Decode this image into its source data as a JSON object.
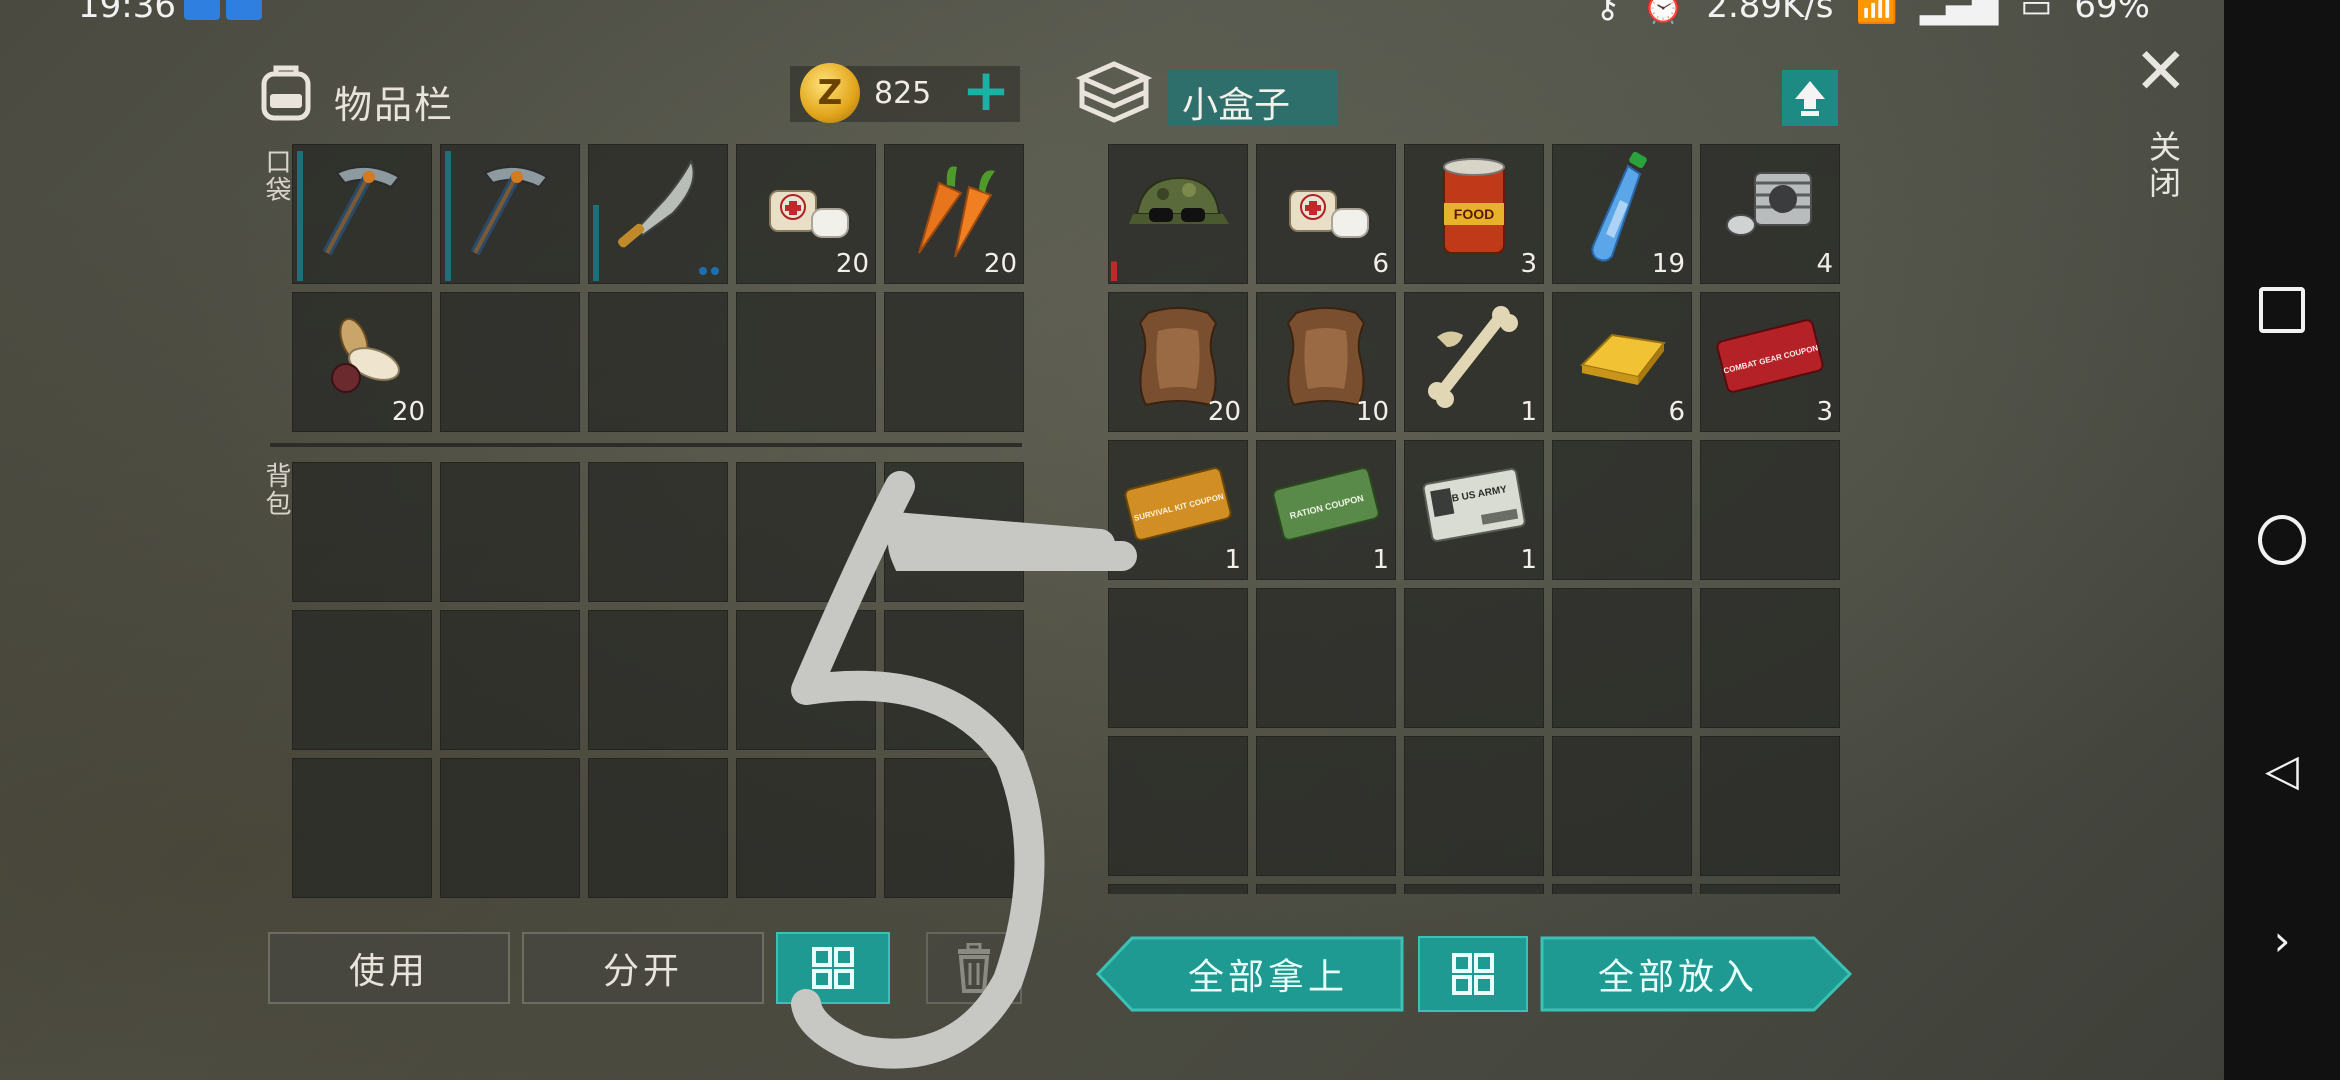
{
  "status_bar": {
    "time": "19:36",
    "network_speed": "2.89K/s",
    "battery": "69%"
  },
  "inventory": {
    "title": "物品栏",
    "icon": "backpack-icon",
    "coins": "825",
    "pocket_label": "口袋",
    "backpack_label": "背包",
    "pocket_slots": [
      {
        "icon": "pickaxe-icon",
        "count": ""
      },
      {
        "icon": "pickaxe-icon",
        "count": ""
      },
      {
        "icon": "machete-icon",
        "count": ""
      },
      {
        "icon": "bandage-icon",
        "count": "20"
      },
      {
        "icon": "carrot-icon",
        "count": "20"
      },
      {
        "icon": "seeds-icon",
        "count": "20"
      },
      {
        "icon": "",
        "count": ""
      },
      {
        "icon": "",
        "count": ""
      },
      {
        "icon": "",
        "count": ""
      },
      {
        "icon": "",
        "count": ""
      }
    ]
  },
  "container": {
    "title": "小盒子",
    "icon": "box-stack-icon",
    "slots": [
      {
        "icon": "camo-cap-icon",
        "count": ""
      },
      {
        "icon": "bandage-icon",
        "count": "6"
      },
      {
        "icon": "food-can-icon",
        "count": "3",
        "text": "FOOD"
      },
      {
        "icon": "water-bottle-icon",
        "count": "19"
      },
      {
        "icon": "engine-cylinder-icon",
        "count": "4"
      },
      {
        "icon": "hide-icon",
        "count": "20"
      },
      {
        "icon": "hide-icon",
        "count": "10"
      },
      {
        "icon": "bones-icon",
        "count": "1"
      },
      {
        "icon": "gold-bar-icon",
        "count": "6"
      },
      {
        "icon": "combat-gear-coupon-icon",
        "count": "3",
        "text": "COMBAT GEAR COUPON"
      },
      {
        "icon": "survival-kit-coupon-icon",
        "count": "1",
        "text": "SURVIVAL KIT COUPON"
      },
      {
        "icon": "ration-coupon-icon",
        "count": "1",
        "text": "RATION COUPON"
      },
      {
        "icon": "us-army-card-icon",
        "count": "1",
        "text": "B US ARMY"
      },
      {
        "icon": "",
        "count": ""
      },
      {
        "icon": "",
        "count": ""
      }
    ]
  },
  "buttons": {
    "use": "使用",
    "split": "分开",
    "take_all": "全部拿上",
    "put_all": "全部放入"
  },
  "close": {
    "label": "关闭"
  },
  "overlay": {
    "drawn_text": "5"
  },
  "colors": {
    "accent": "#1f9a92",
    "coin": "#e2a51b"
  }
}
